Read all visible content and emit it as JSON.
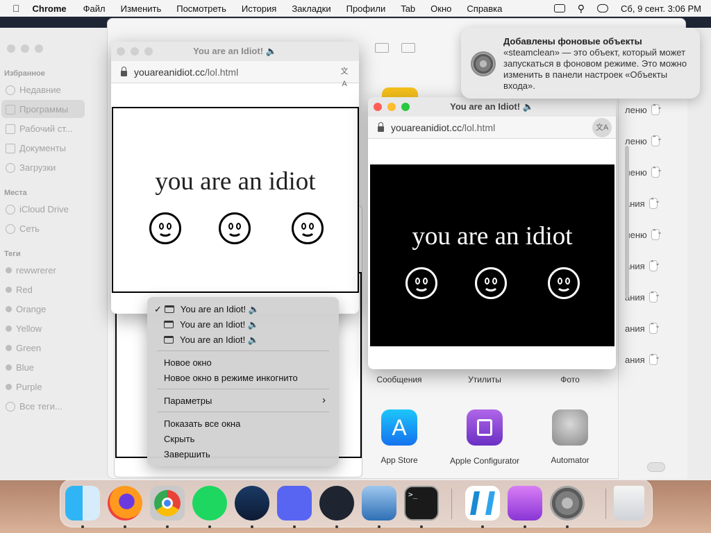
{
  "menubar": {
    "apple": "",
    "app": "Chrome",
    "items": [
      "Файл",
      "Изменить",
      "Посмотреть",
      "История",
      "Закладки",
      "Профили",
      "Tab",
      "Окно",
      "Справка"
    ],
    "datetime": "Сб, 9 сент.  3:06 PM"
  },
  "finder": {
    "sidebar": {
      "favorites_header": "Избранное",
      "favorites": [
        "Недавние",
        "Программы",
        "Рабочий ст...",
        "Документы",
        "Загрузки"
      ],
      "places_header": "Места",
      "places": [
        "iCloud Drive",
        "Сеть"
      ],
      "tags_header": "Теги",
      "tags": [
        "rewwrerer",
        "Red",
        "Orange",
        "Yellow",
        "Green",
        "Blue",
        "Purple",
        "Все теги..."
      ]
    }
  },
  "prefs_rows": [
    "леню",
    "леню",
    "леню",
    "ания",
    "леню",
    "ания",
    "ания",
    "ания",
    "ания"
  ],
  "popup_left": {
    "title": "You are an Idiot! 🔈",
    "url_domain": "youareanidiot.cc",
    "url_path": "/lol.html",
    "text": "you are an idiot"
  },
  "popup_right": {
    "title": "You are an Idiot! 🔈",
    "url_domain": "youareanidiot.cc",
    "url_path": "/lol.html",
    "text": "you are an idiot"
  },
  "context_menu": {
    "windows": [
      "You are an Idiot! 🔈",
      "You are an Idiot! 🔈",
      "You are an Idiot! 🔈"
    ],
    "check": "✓",
    "new_window": "Новое окно",
    "new_incognito": "Новое окно в режиме инкогнито",
    "options": "Параметры",
    "show_all": "Показать все окна",
    "hide": "Скрыть",
    "quit": "Завершить"
  },
  "notification": {
    "title": "Добавлены фоновые объекты",
    "body": "«steamclean» — это объект, который может запускаться в фоновом режиме. Это можно изменить в панели настроек «Объекты входа»."
  },
  "apps": {
    "row_labels": [
      "Сообщения",
      "Утилиты",
      "Фото"
    ],
    "app_store": "App Store",
    "apple_configurator": "Apple Configurator",
    "automator": "Automator"
  },
  "dock": [
    "finder-icon",
    "firefox-icon",
    "chrome-icon",
    "spotify-icon",
    "steam-icon",
    "discord-icon",
    "obs-icon",
    "virtualbox-icon",
    "terminal-icon",
    "vscode-icon",
    "podcasts-icon",
    "system-settings-icon",
    "trash-icon"
  ]
}
